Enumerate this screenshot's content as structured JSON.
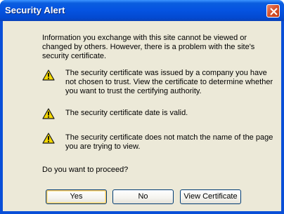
{
  "window": {
    "title": "Security Alert"
  },
  "content": {
    "intro": "Information you exchange with this site cannot be viewed or changed by others. However, there is a problem with the site's security certificate.",
    "items": [
      {
        "icon": "warning-icon",
        "text": "The security certificate was issued by a company you have not chosen to trust. View the certificate to determine whether you want to trust the certifying authority."
      },
      {
        "icon": "warning-icon",
        "text": "The security certificate date is valid."
      },
      {
        "icon": "warning-icon",
        "text": "The security certificate does not match the name of the page you are trying to view."
      }
    ],
    "question": "Do you want to proceed?"
  },
  "buttons": {
    "yes": "Yes",
    "no": "No",
    "view_certificate": "View Certificate"
  },
  "colors": {
    "titlebar": "#0553e1",
    "dialog_bg": "#ece9d8",
    "close_button": "#d8552f",
    "warning_yellow": "#f5d800"
  }
}
